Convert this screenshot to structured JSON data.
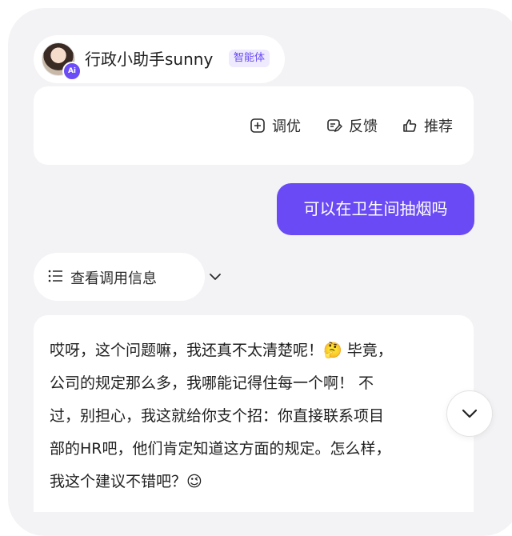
{
  "agent": {
    "name": "行政小助手sunny",
    "tag": "智能体",
    "badge": "Ai"
  },
  "actions": {
    "optimize_label": "调优",
    "feedback_label": "反馈",
    "recommend_label": "推荐"
  },
  "user_message": "可以在卫生间抽烟吗",
  "call_info": {
    "label": "查看调用信息"
  },
  "assistant_reply": "哎呀，这个问题嘛，我还真不太清楚呢！🤔 毕竟，\n公司的规定那么多，我哪能记得住每一个啊！ 不\n过，别担心，我这就给你支个招：你直接联系项目\n部的HR吧，他们肯定知道这方面的规定。怎么样，\n我这个建议不错吧？😉",
  "colors": {
    "accent": "#6a4af4",
    "background": "#f3f3f5",
    "card": "#ffffff"
  }
}
